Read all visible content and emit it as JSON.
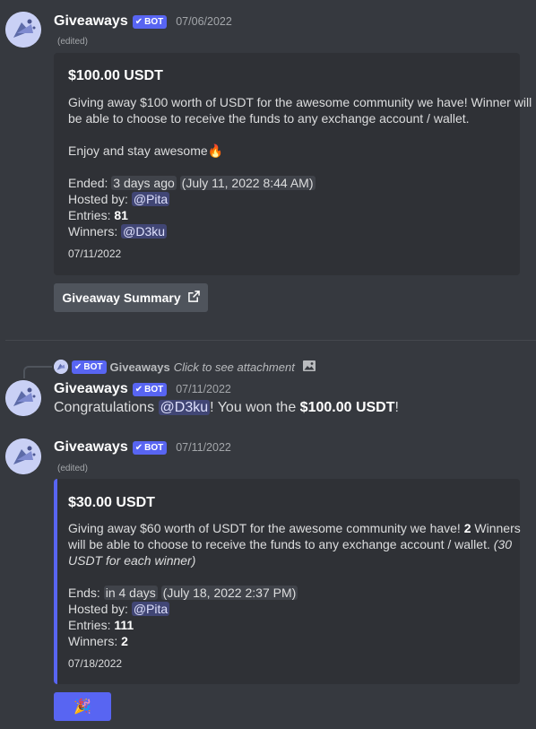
{
  "messages": [
    {
      "author": "Giveaways",
      "bot_tag": "BOT",
      "timestamp": "07/06/2022",
      "edited": "(edited)",
      "embed": {
        "title": "$100.00 USDT",
        "desc_line1": "Giving away $100 worth of USDT for the awesome community we have! Winner will",
        "desc_line2": "be able to choose to receive the funds to any exchange account / wallet.",
        "desc_line3": "Enjoy and stay awesome",
        "emoji": "🔥",
        "ended_label": "Ended:",
        "ended_relative": "3 days ago",
        "ended_absolute": "July 11, 2022 8:44 AM",
        "hosted_label": "Hosted by:",
        "host": "@Pita",
        "entries_label": "Entries:",
        "entries": "81",
        "winners_label": "Winners:",
        "winners": "@D3ku",
        "footer": "07/11/2022"
      },
      "button": {
        "label": "Giveaway Summary",
        "icon": "external-link-icon"
      }
    },
    {
      "reply": {
        "bot_tag": "BOT",
        "author": "Giveaways",
        "text": "Click to see attachment",
        "icon": "image-icon"
      },
      "author": "Giveaways",
      "bot_tag": "BOT",
      "timestamp": "07/11/2022",
      "content": {
        "prefix": "Congratulations",
        "mention": "@D3ku",
        "middle": "! You won the",
        "prize": "$100.00 USDT",
        "suffix": "!"
      }
    },
    {
      "author": "Giveaways",
      "bot_tag": "BOT",
      "timestamp": "07/11/2022",
      "edited": "(edited)",
      "embed": {
        "title": "$30.00 USDT",
        "desc_line1_a": "Giving away $60 worth of USDT for the awesome community we have!",
        "desc_line1_b": "2",
        "desc_line1_c": "Winners",
        "desc_line2_a": "will be able to choose to receive the funds to any exchange account / wallet.",
        "desc_line2_b": "(30",
        "desc_line3": "USDT for each winner)",
        "ends_label": "Ends:",
        "ends_relative": "in 4 days",
        "ends_absolute": "July 18, 2022 2:37 PM",
        "hosted_label": "Hosted by:",
        "host": "@Pita",
        "entries_label": "Entries:",
        "entries": "111",
        "winners_label": "Winners:",
        "winners": "2",
        "footer": "07/18/2022"
      },
      "button": {
        "emoji": "🎉",
        "icon": "party-popper-icon"
      }
    }
  ],
  "colors": {
    "background": "#36393f",
    "embed": "#2f3136",
    "accent": "#5865f2",
    "mention": "#414675"
  }
}
